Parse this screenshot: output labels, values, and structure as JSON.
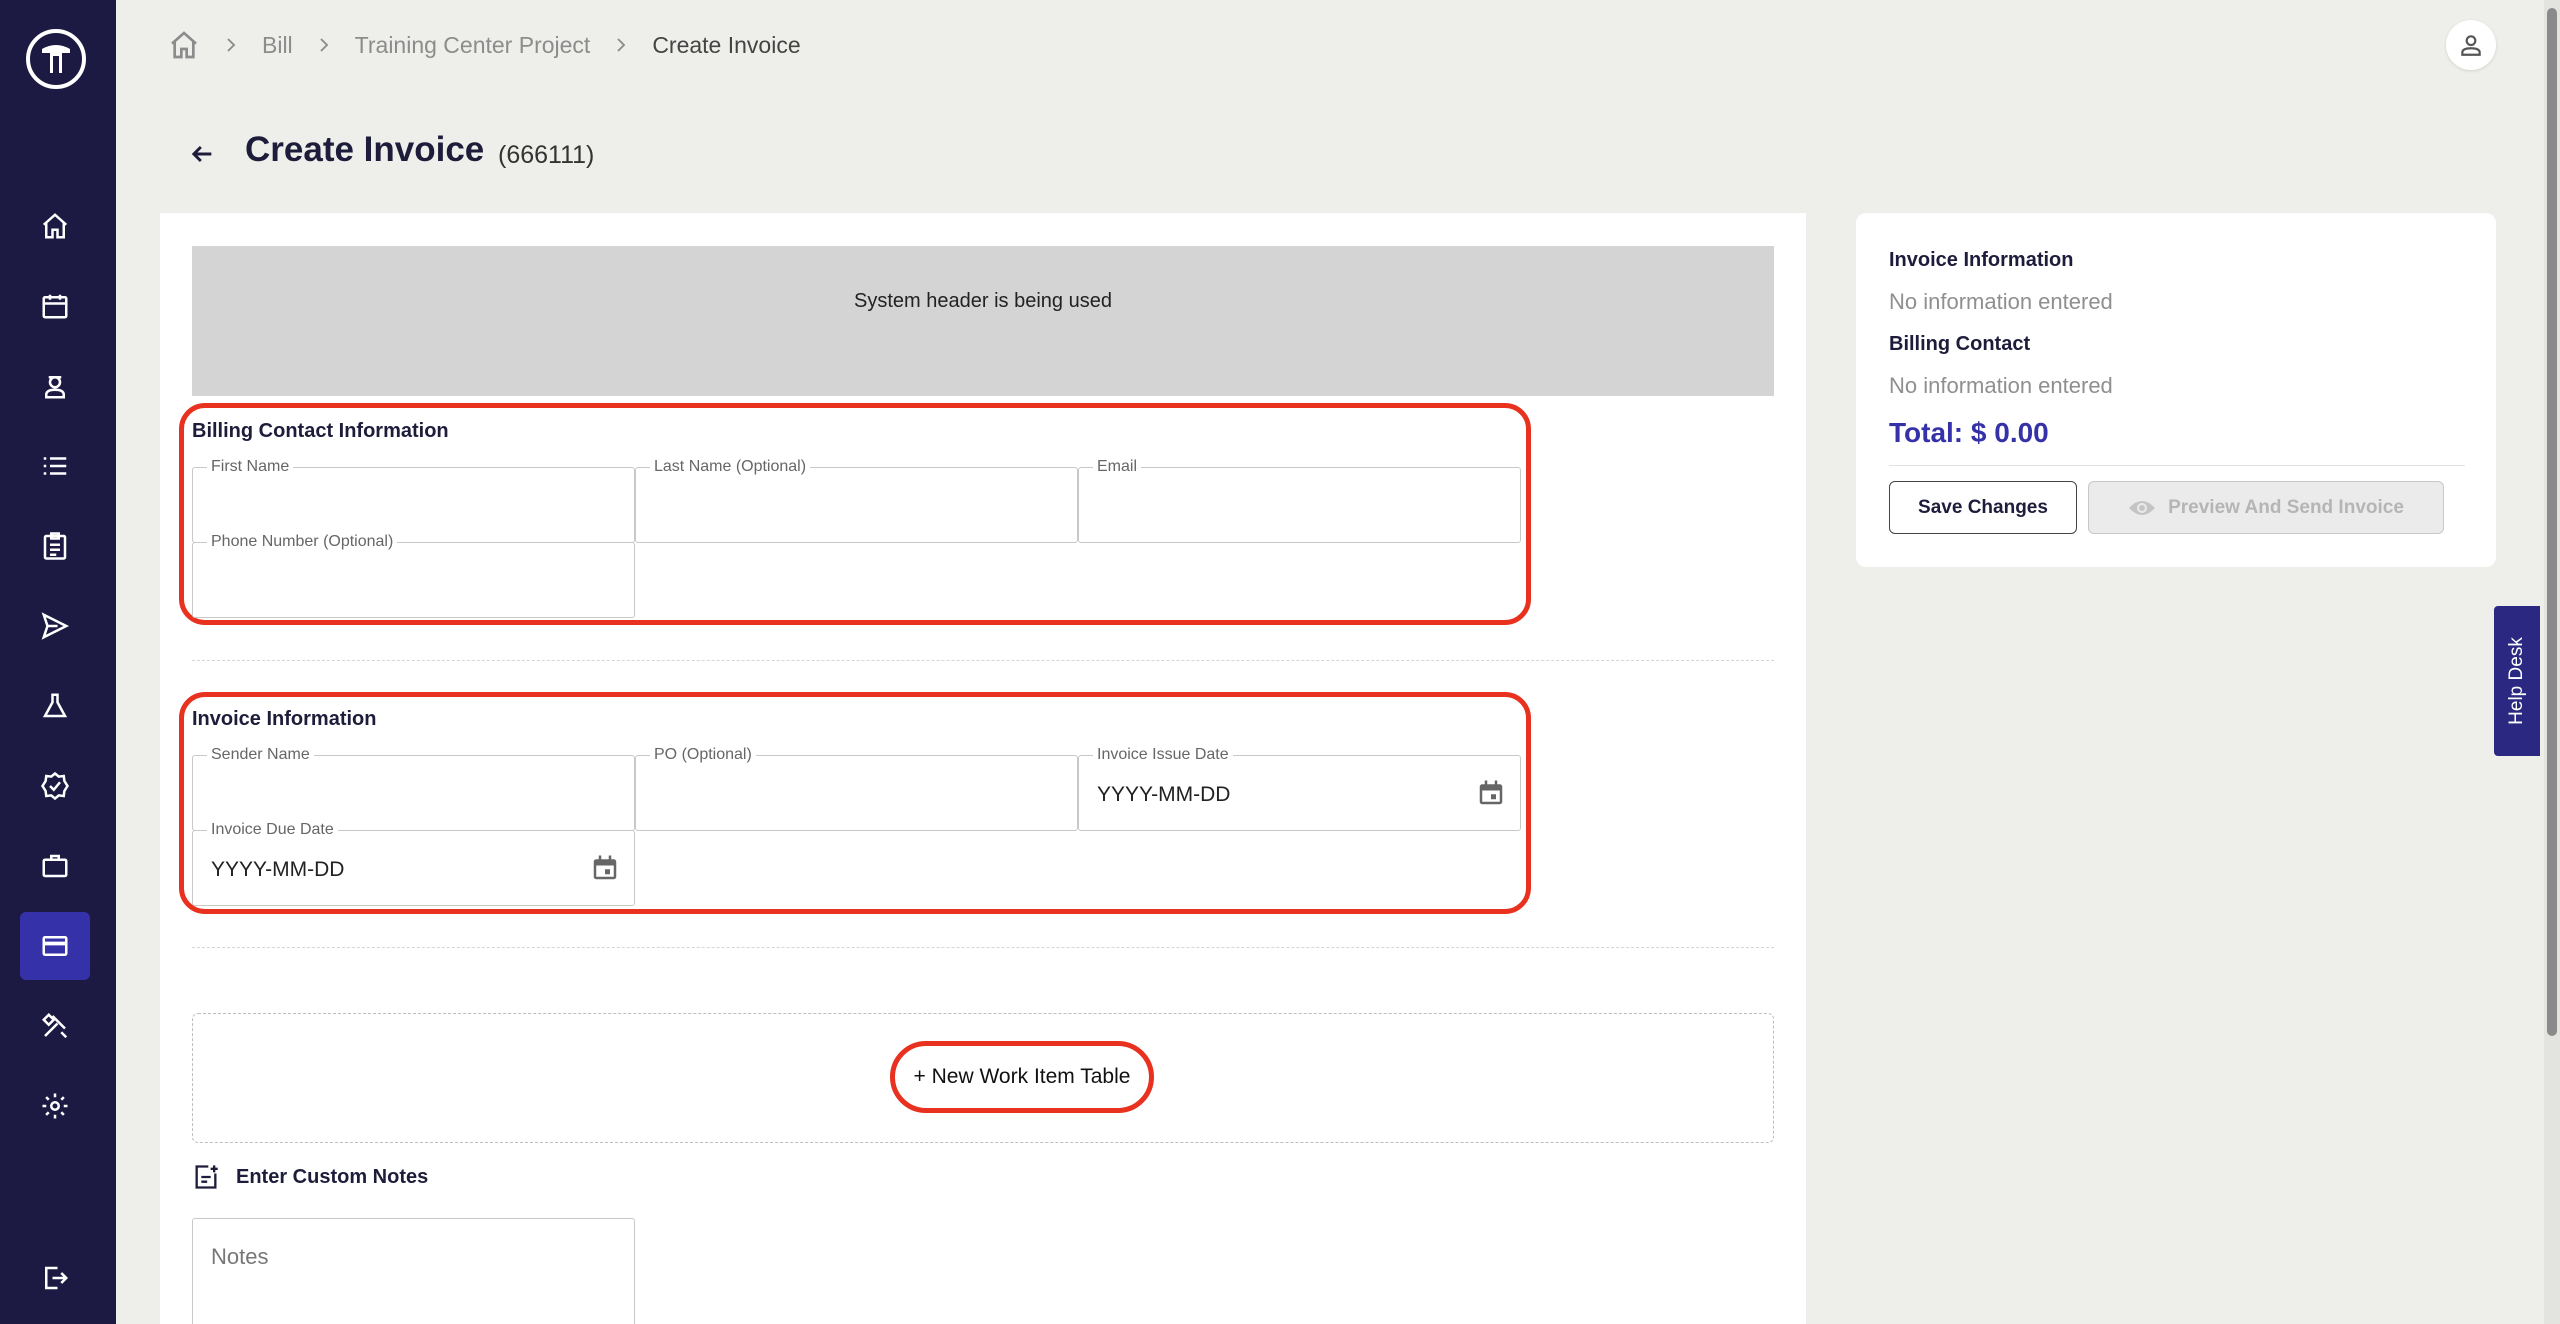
{
  "breadcrumb": {
    "items": [
      "Bill",
      "Training Center Project"
    ],
    "current": "Create Invoice"
  },
  "page": {
    "title": "Create Invoice",
    "invoice_id": "(666111)"
  },
  "form": {
    "system_header": "System header is being used",
    "billing": {
      "title": "Billing Contact Information",
      "first_name_label": "First Name",
      "last_name_label": "Last Name (Optional)",
      "email_label": "Email",
      "phone_label": "Phone Number (Optional)"
    },
    "invoice": {
      "title": "Invoice Information",
      "sender_label": "Sender Name",
      "po_label": "PO (Optional)",
      "issue_date_label": "Invoice Issue Date",
      "issue_date_value": "YYYY-MM-DD",
      "due_date_label": "Invoice Due Date",
      "due_date_value": "YYYY-MM-DD"
    },
    "new_work_item_label": "+ New Work Item Table",
    "notes_title": "Enter Custom Notes",
    "notes_placeholder": "Notes"
  },
  "summary": {
    "invoice_info_title": "Invoice Information",
    "invoice_info_value": "No information entered",
    "billing_title": "Billing Contact",
    "billing_value": "No information entered",
    "total": "Total: $ 0.00",
    "save_label": "Save Changes",
    "preview_label": "Preview And Send Invoice"
  },
  "helpdesk_label": "Help Desk",
  "colors": {
    "sidebar": "#1c1a42",
    "accent": "#3531a8",
    "highlight": "#e8321f"
  },
  "sidebar_icons": [
    "home-icon",
    "calendar-icon",
    "person-icon",
    "list-icon",
    "clipboard-icon",
    "send-icon",
    "flask-icon",
    "badge-check-icon",
    "briefcase-icon",
    "credit-card-icon",
    "tools-icon",
    "gear-icon",
    "logout-icon"
  ]
}
